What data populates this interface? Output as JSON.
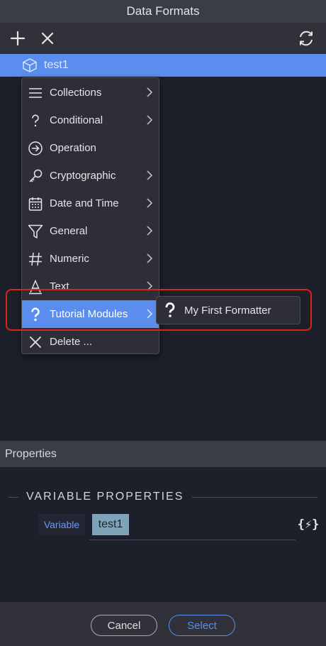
{
  "window": {
    "title": "Data Formats"
  },
  "toolbar": {
    "add_icon": "plus-icon",
    "remove_icon": "x-icon",
    "refresh_icon": "refresh-icon"
  },
  "tree": {
    "selected_item": "test1",
    "item_icon": "cube-icon"
  },
  "context_menu": {
    "items": [
      {
        "label": "Collections",
        "icon": "list-icon",
        "has_submenu": true
      },
      {
        "label": "Conditional",
        "icon": "question-icon",
        "has_submenu": true
      },
      {
        "label": "Operation",
        "icon": "arrow-circle-icon",
        "has_submenu": false
      },
      {
        "label": "Cryptographic",
        "icon": "key-icon",
        "has_submenu": true
      },
      {
        "label": "Date and Time",
        "icon": "calendar-icon",
        "has_submenu": true
      },
      {
        "label": "General",
        "icon": "filter-icon",
        "has_submenu": true
      },
      {
        "label": "Numeric",
        "icon": "hash-icon",
        "has_submenu": true
      },
      {
        "label": "Text",
        "icon": "text-icon",
        "has_submenu": true
      },
      {
        "label": "Tutorial Modules",
        "icon": "question-icon",
        "has_submenu": true,
        "active": true
      },
      {
        "label": "Delete ...",
        "icon": "x-icon",
        "has_submenu": false
      }
    ]
  },
  "submenu": {
    "items": [
      {
        "label": "My First Formatter",
        "icon": "question-icon"
      }
    ]
  },
  "properties": {
    "header": "Properties",
    "section_title": "VARIABLE PROPERTIES",
    "variable_label": "Variable",
    "variable_value": "test1",
    "dynamic_icon": "{⚡}"
  },
  "footer": {
    "cancel_label": "Cancel",
    "select_label": "Select"
  },
  "colors": {
    "accent": "#5b8def",
    "highlight_border": "#e0201e",
    "background": "#1d1f2a",
    "panel": "#3b3d46"
  }
}
